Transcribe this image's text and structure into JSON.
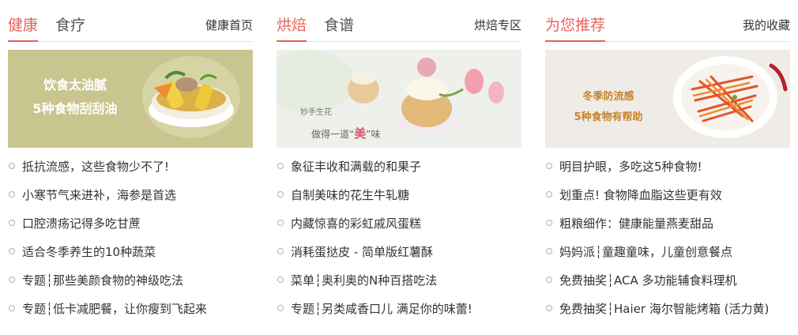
{
  "columns": [
    {
      "tabs": [
        {
          "label": "健康",
          "active": true
        },
        {
          "label": "食疗",
          "active": false
        }
      ],
      "more_link": "健康首页",
      "banner": {
        "lines": [
          "饮食太油腻",
          "5种食物刮刮油"
        ],
        "bg_color": "#c8c68e",
        "text_color": "#ffffff"
      },
      "items": [
        "抵抗流感，这些食物少不了!",
        "小寒节气来进补，海参是首选",
        "口腔溃疡记得多吃甘蔗",
        "适合冬季养生的10种蔬菜",
        "专题┆那些美颜食物的神级吃法",
        "专题┆低卡减肥餐，让你瘦到飞起来"
      ]
    },
    {
      "tabs": [
        {
          "label": "烘焙",
          "active": true
        },
        {
          "label": "食谱",
          "active": false
        }
      ],
      "more_link": "烘焙专区",
      "banner": {
        "caption_small": "妙手生花",
        "caption_pre": "做得一道“",
        "caption_mid": "美",
        "caption_post": "”味",
        "bg_color": "#eef0ec"
      },
      "items": [
        "象征丰收和满载的和果子",
        "自制美味的花生牛轧糖",
        "内藏惊喜的彩虹戚风蛋糕",
        "消耗蛋挞皮 - 简单版红薯酥",
        "菜单┆奥利奥的N种百搭吃法",
        "专题┆另类咸香口儿 满足你的味蕾!"
      ]
    },
    {
      "tabs": [
        {
          "label": "为您推荐",
          "active": true
        }
      ],
      "more_link": "我的收藏",
      "banner": {
        "lines": [
          "冬季防流感",
          "5种食物有帮助"
        ],
        "bg_color": "#efece8",
        "text_color": "#c8822a"
      },
      "items": [
        "明目护眼，多吃这5种食物!",
        "划重点! 食物降血脂这些更有效",
        "粗粮细作：健康能量燕麦甜品",
        "妈妈派┆童趣童味，儿童创意餐点",
        "免费抽奖┆ACA 多功能辅食料理机",
        "免费抽奖┆Haier 海尔智能烤箱 (活力黄)"
      ]
    }
  ]
}
